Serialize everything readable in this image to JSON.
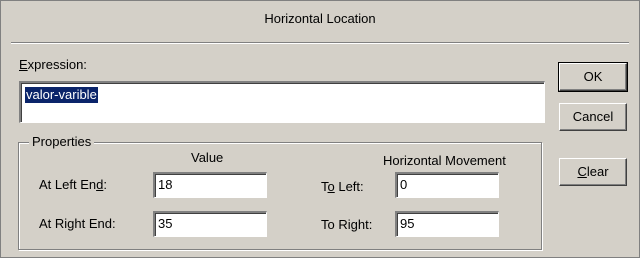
{
  "dialog": {
    "title": "Horizontal Location"
  },
  "expression": {
    "label_mnemonic": "E",
    "label_rest": "xpression:",
    "value": "valor-varible"
  },
  "properties": {
    "legend": "Properties",
    "value_header": "Value",
    "movement_header": "Horizontal Movement",
    "left_end_label_pre": "At Left En",
    "left_end_label_mnemonic": "d",
    "left_end_label_post": ":",
    "left_end_value": "18",
    "right_end_label_pre": "At Ri",
    "right_end_label_mnemonic": "g",
    "right_end_label_post": "ht End:",
    "right_end_value": "35",
    "to_left_label_pre": "T",
    "to_left_label_mnemonic": "o",
    "to_left_label_post": " Left:",
    "to_left_value": "0",
    "to_right_label_pre": "To Ri",
    "to_right_label_mnemonic": "g",
    "to_right_label_post": "ht:",
    "to_right_value": "95"
  },
  "buttons": {
    "ok": "OK",
    "cancel": "Cancel",
    "clear_mnemonic": "C",
    "clear_rest": "lear"
  }
}
